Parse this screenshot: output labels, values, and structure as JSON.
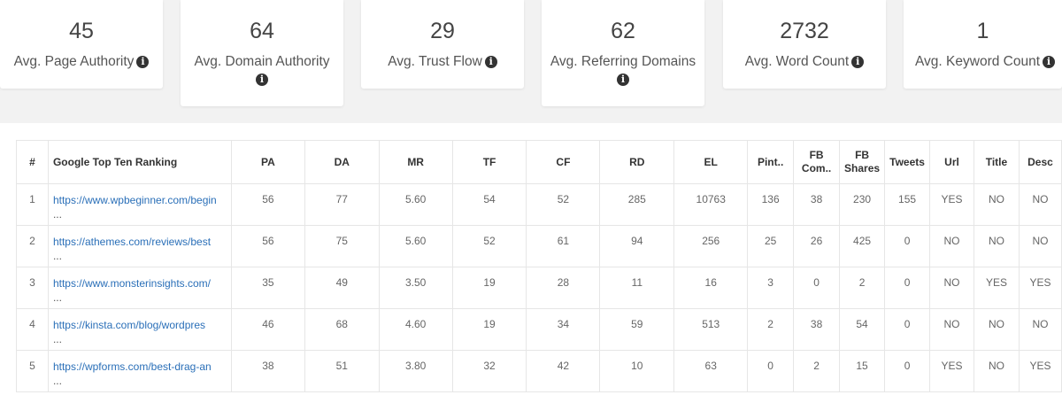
{
  "stats": [
    {
      "value": "45",
      "label": "Avg. Page Authority"
    },
    {
      "value": "64",
      "label": "Avg. Domain Authority"
    },
    {
      "value": "29",
      "label": "Avg. Trust Flow"
    },
    {
      "value": "62",
      "label": "Avg. Referring Domains"
    },
    {
      "value": "2732",
      "label": "Avg. Word Count"
    },
    {
      "value": "1",
      "label": "Avg. Keyword Count"
    }
  ],
  "icons": {
    "info": "info-icon",
    "info_glyph": "i"
  },
  "table": {
    "headers": [
      "#",
      "Google Top Ten Ranking",
      "PA",
      "DA",
      "MR",
      "TF",
      "CF",
      "RD",
      "EL",
      "Pint..",
      "FB Com..",
      "FB Shares",
      "Tweets",
      "Url",
      "Title",
      "Desc"
    ],
    "header_lines": {
      "fb_com": [
        "FB",
        "Com.."
      ],
      "fb_shares": [
        "FB",
        "Shares"
      ]
    },
    "rows": [
      {
        "num": "1",
        "url": "https://www.wpbeginner.com/begin",
        "ellipsis": "...",
        "pa": "56",
        "da": "77",
        "mr": "5.60",
        "tf": "54",
        "cf": "52",
        "rd": "285",
        "el": "10763",
        "pint": "136",
        "fb_com": "38",
        "fb_shares": "230",
        "tweets": "155",
        "url_flag": "YES",
        "title_flag": "NO",
        "desc_flag": "NO"
      },
      {
        "num": "2",
        "url": "https://athemes.com/reviews/best",
        "ellipsis": "...",
        "pa": "56",
        "da": "75",
        "mr": "5.60",
        "tf": "52",
        "cf": "61",
        "rd": "94",
        "el": "256",
        "pint": "25",
        "fb_com": "26",
        "fb_shares": "425",
        "tweets": "0",
        "url_flag": "NO",
        "title_flag": "NO",
        "desc_flag": "NO"
      },
      {
        "num": "3",
        "url": "https://www.monsterinsights.com/",
        "ellipsis": "...",
        "pa": "35",
        "da": "49",
        "mr": "3.50",
        "tf": "19",
        "cf": "28",
        "rd": "11",
        "el": "16",
        "pint": "3",
        "fb_com": "0",
        "fb_shares": "2",
        "tweets": "0",
        "url_flag": "NO",
        "title_flag": "YES",
        "desc_flag": "YES"
      },
      {
        "num": "4",
        "url": "https://kinsta.com/blog/wordpres",
        "ellipsis": "...",
        "pa": "46",
        "da": "68",
        "mr": "4.60",
        "tf": "19",
        "cf": "34",
        "rd": "59",
        "el": "513",
        "pint": "2",
        "fb_com": "38",
        "fb_shares": "54",
        "tweets": "0",
        "url_flag": "NO",
        "title_flag": "NO",
        "desc_flag": "NO"
      },
      {
        "num": "5",
        "url": "https://wpforms.com/best-drag-an",
        "ellipsis": "...",
        "pa": "38",
        "da": "51",
        "mr": "3.80",
        "tf": "32",
        "cf": "42",
        "rd": "10",
        "el": "63",
        "pint": "0",
        "fb_com": "2",
        "fb_shares": "15",
        "tweets": "0",
        "url_flag": "YES",
        "title_flag": "NO",
        "desc_flag": "YES"
      }
    ]
  }
}
